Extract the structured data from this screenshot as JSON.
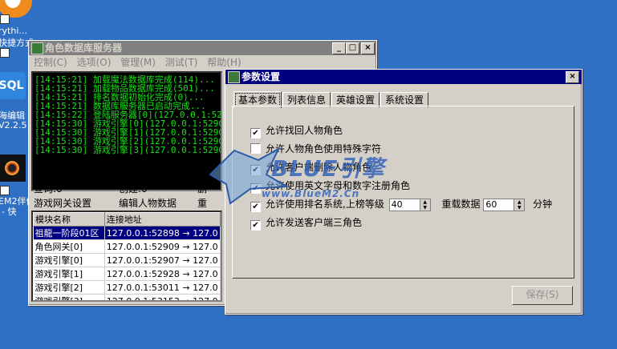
{
  "desktop": {
    "labels": [
      "rythi...",
      "快捷方式",
      "海编辑",
      "V2.2.5",
      "EM2伴侣",
      "- 快"
    ],
    "sql_icon_text": "SQL"
  },
  "server_window": {
    "title": "角色数据库服务器",
    "menu": [
      "控制(C)",
      "选项(O)",
      "管理(M)",
      "测试(T)",
      "帮助(H)"
    ],
    "log_lines": [
      "[14:15:21] 加载魔法数据库完成(114)...",
      "[14:15:21] 加载物品数据库完成(501)...",
      "[14:15:21] 排名数据初始化完成(0)...",
      "[14:15:21] 数据库服务器已启动完成...",
      "[14:15:22] 登陆服务器[0](127.0.0.1:52898)",
      "[14:15:30] 游戏引擎[0](127.0.0.1:52904)已",
      "[14:15:30] 游戏引擎[1](127.0.0.1:52905)",
      "[14:15:30] 游戏引擎[2](127.0.0.1:52906)",
      "[14:15:30] 游戏引擎[3](127.0.0.1:52907)"
    ],
    "stats": {
      "connections": "连接:4",
      "users": "用户:0",
      "col3_top": "读",
      "query": "查询:0",
      "create": "创建:0",
      "col3_bottom": "删"
    },
    "actions": {
      "gateway_settings": "游戏网关设置",
      "edit_character": "编辑人物数据",
      "more": "重"
    },
    "grid": {
      "headers": [
        "模块名称",
        "连接地址"
      ],
      "rows": [
        [
          "祖龍一阶段01区",
          "127.0.0.1:52898 → 127.0"
        ],
        [
          "角色网关[0]",
          "127.0.0.1:52909 → 127.0"
        ],
        [
          "游戏引擎[0]",
          "127.0.0.1:52907 → 127.0"
        ],
        [
          "游戏引擎[1]",
          "127.0.0.1:52928 → 127.0"
        ],
        [
          "游戏引擎[2]",
          "127.0.0.1:53011 → 127.0"
        ],
        [
          "游戏引擎[3]",
          "127.0.0.1:53153 → 127.0"
        ]
      ]
    }
  },
  "settings_dialog": {
    "title": "参数设置",
    "tabs": [
      "基本参数",
      "列表信息",
      "英雄设置",
      "系统设置"
    ],
    "options": [
      {
        "label": "允许找回人物角色",
        "checked": true
      },
      {
        "label": "允许人物角色使用特殊字符",
        "checked": false
      },
      {
        "label": "允许客户端删除人物角色",
        "checked": true
      },
      {
        "label": "允许使用英文字母和数字注册角色",
        "checked": true
      },
      {
        "label": "允许使用排名系统,上榜等级",
        "checked": true
      },
      {
        "label": "允许发送客户端三角色",
        "checked": true
      }
    ],
    "rank_level": "40",
    "reload_label": "重载数据",
    "reload_value": "60",
    "minutes_label": "分钟",
    "save_button": "保存(S)"
  },
  "watermark": {
    "brand": "BLUE引擎",
    "url": "www.BlueM2.Cn"
  },
  "colors": {
    "desktop": "#2f6fc4",
    "active_title": "#000080",
    "inactive_title": "#808080",
    "log_text": "#15e415"
  }
}
